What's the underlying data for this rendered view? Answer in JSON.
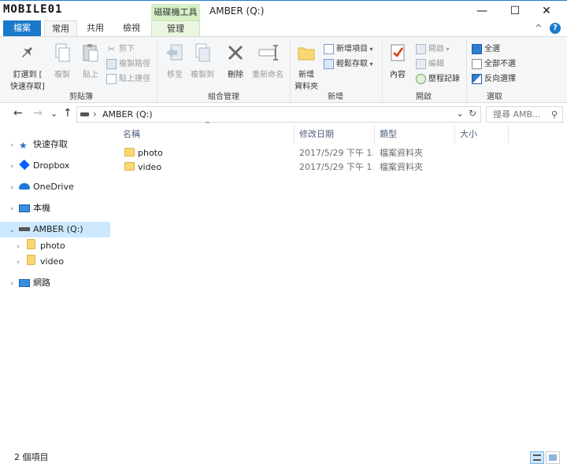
{
  "watermark": {
    "logo": "MOBILE01"
  },
  "titlebar": {
    "context_tab": "磁碟機工具",
    "title": "AMBER (Q:)",
    "minimize": "—",
    "maximize": "☐",
    "close": "✕"
  },
  "tabs": {
    "file": "檔案",
    "home": "常用",
    "share": "共用",
    "view": "檢視",
    "manage": "管理",
    "collapse": "^",
    "help": "?"
  },
  "ribbon": {
    "clipboard": {
      "pin_label_1": "釘選到 [",
      "pin_label_2": "快速存取]",
      "copy": "複製",
      "paste": "貼上",
      "cut": "剪下",
      "copy_path": "複製路徑",
      "paste_shortcut": "貼上捷徑",
      "group": "剪貼簿"
    },
    "organize": {
      "move_to": "移至",
      "copy_to": "複製到",
      "delete": "刪除",
      "rename": "重新命名",
      "group": "組合管理"
    },
    "new": {
      "new_folder_1": "新增",
      "new_folder_2": "資料夾",
      "new_item": "新增項目",
      "easy_access": "輕鬆存取",
      "group": "新增"
    },
    "open": {
      "properties": "內容",
      "open": "開啟",
      "edit": "編輯",
      "history": "歷程記錄",
      "group": "開啟"
    },
    "select": {
      "select_all": "全選",
      "select_none": "全部不選",
      "invert": "反向選擇",
      "group": "選取"
    }
  },
  "address": {
    "back": "←",
    "forward": "→",
    "recent": "⌄",
    "up": "↑",
    "separator": "›",
    "path": "AMBER (Q:)",
    "search_placeholder": "搜尋 AMB...",
    "dropdown": "⌄",
    "refresh": "↻"
  },
  "nav": [
    {
      "label": "快速存取",
      "chev": "›",
      "icon": "star-icon"
    },
    {
      "label": "Dropbox",
      "chev": "›",
      "icon": "dropbox-icon"
    },
    {
      "label": "OneDrive",
      "chev": "›",
      "icon": "onedrive-icon"
    },
    {
      "label": "本機",
      "chev": "›",
      "icon": "computer-icon"
    },
    {
      "label": "AMBER (Q:)",
      "chev": "⌄",
      "icon": "drive-icon"
    },
    {
      "label": "photo",
      "chev": "›",
      "icon": "folder-icon"
    },
    {
      "label": "video",
      "chev": "›",
      "icon": "folder-icon"
    },
    {
      "label": "網路",
      "chev": "›",
      "icon": "network-icon"
    }
  ],
  "columns": {
    "name": "名稱",
    "date": "修改日期",
    "type": "類型",
    "size": "大小",
    "sort_indicator": "^"
  },
  "files": [
    {
      "name": "photo",
      "date": "2017/5/29 下午 1...",
      "type": "檔案資料夾",
      "size": ""
    },
    {
      "name": "video",
      "date": "2017/5/29 下午 1...",
      "type": "檔案資料夾",
      "size": ""
    }
  ],
  "status": {
    "count": "2 個項目"
  },
  "colors": {
    "file_tab": "#1979ca",
    "manage_tab": "#d6f0c6",
    "selected": "#cce8ff",
    "folder": "#f8d774"
  }
}
